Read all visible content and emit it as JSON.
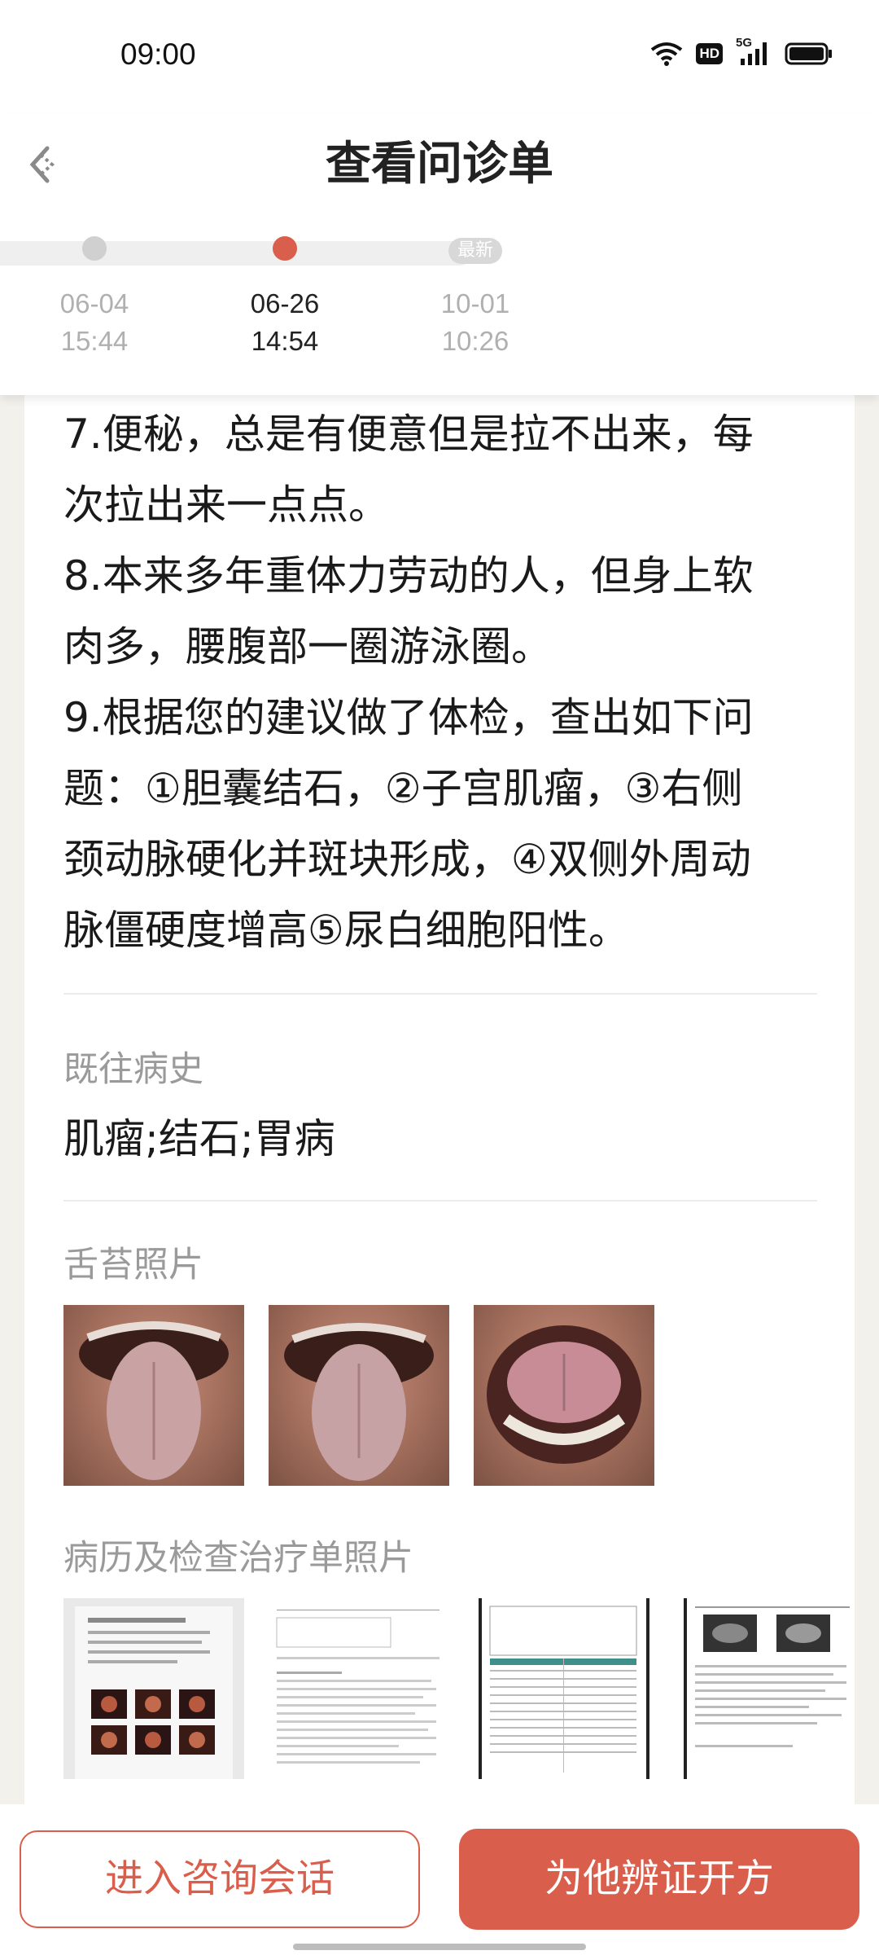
{
  "status_bar": {
    "time": "09:00",
    "hd": "HD",
    "network": "5G"
  },
  "header": {
    "title": "查看问诊单",
    "timeline": [
      {
        "date": "06-04",
        "time": "15:44",
        "active": false
      },
      {
        "date": "06-26",
        "time": "14:54",
        "active": true
      },
      {
        "date": "10-01",
        "time": "10:26",
        "active": false
      }
    ],
    "latest_badge": "最新"
  },
  "content": {
    "symptom_lines": [
      "7.便秘，总是有便意但是拉不出来，每",
      "次拉出来一点点。",
      "8.本来多年重体力劳动的人，但身上软",
      "肉多，腰腹部一圈游泳圈。",
      "9.根据您的建议做了体检，查出如下问",
      "题：①胆囊结石，②子宫肌瘤，③右侧",
      "颈动脉硬化并斑块形成，④双侧外周动",
      "脉僵硬度增高⑤尿白细胞阳性。"
    ],
    "history_label": "既往病史",
    "history_value": "肌瘤;结石;胃病",
    "tongue_label": "舌苔照片",
    "records_label": "病历及检查治疗单照片"
  },
  "actions": {
    "consult_label": "进入咨询会话",
    "prescribe_label": "为他辨证开方"
  },
  "colors": {
    "accent": "#d95e4b",
    "background": "#f3f1ec"
  }
}
